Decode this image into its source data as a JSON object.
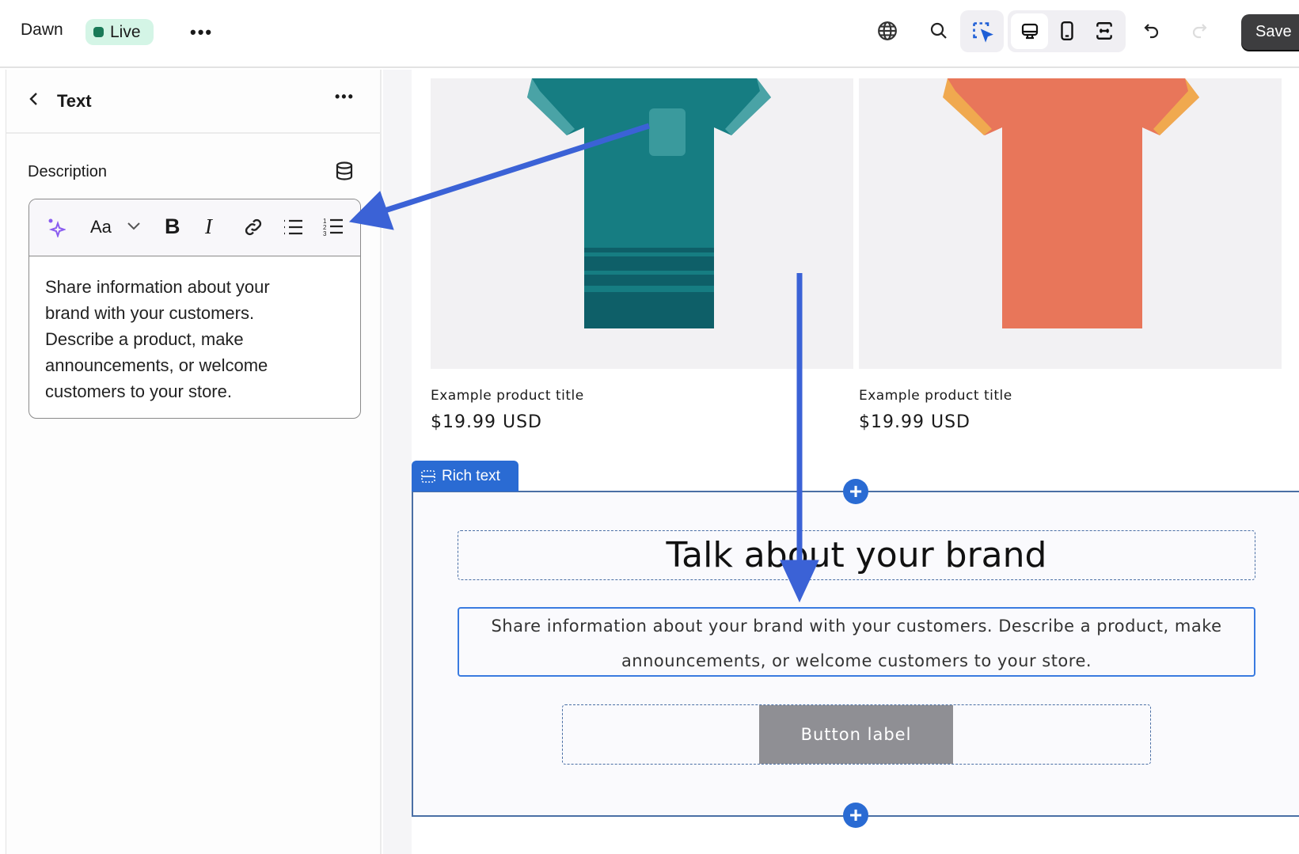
{
  "topbar": {
    "store_name": "Dawn",
    "status": "Live",
    "more": "•••",
    "save_label": "Save",
    "icons": [
      "globe-icon",
      "search-icon",
      "inspector-icon",
      "desktop-icon",
      "mobile-icon",
      "fullwidth-icon",
      "undo-icon",
      "redo-icon"
    ]
  },
  "sidebar": {
    "title": "Text",
    "more": "•••",
    "field_label": "Description",
    "toolbar": {
      "font_label": "Aa",
      "icons": [
        "ai-sparkle-icon",
        "font-icon",
        "chevron-down-icon",
        "bold-icon",
        "italic-icon",
        "link-icon",
        "bullet-list-icon",
        "numbered-list-icon"
      ]
    },
    "text_lines": [
      "Share information about your",
      "brand with your customers.",
      "Describe a product, make",
      "announcements, or welcome",
      "customers to your store."
    ]
  },
  "products": [
    {
      "title": "Example product title",
      "price": "$19.99 USD",
      "color": "#167d82"
    },
    {
      "title": "Example product title",
      "price": "$19.99 USD",
      "color": "#e8765a"
    }
  ],
  "rich_text": {
    "tab_label": "Rich text",
    "heading": "Talk about your brand",
    "text_lines": [
      "Share information about your brand with your customers. Describe a product, make",
      "announcements, or welcome customers to your store."
    ],
    "button_label": "Button label"
  },
  "colors": {
    "accent": "#2a6bd3",
    "annotation_arrow": "#3b62d6",
    "live_bg": "#d4f5e6"
  }
}
